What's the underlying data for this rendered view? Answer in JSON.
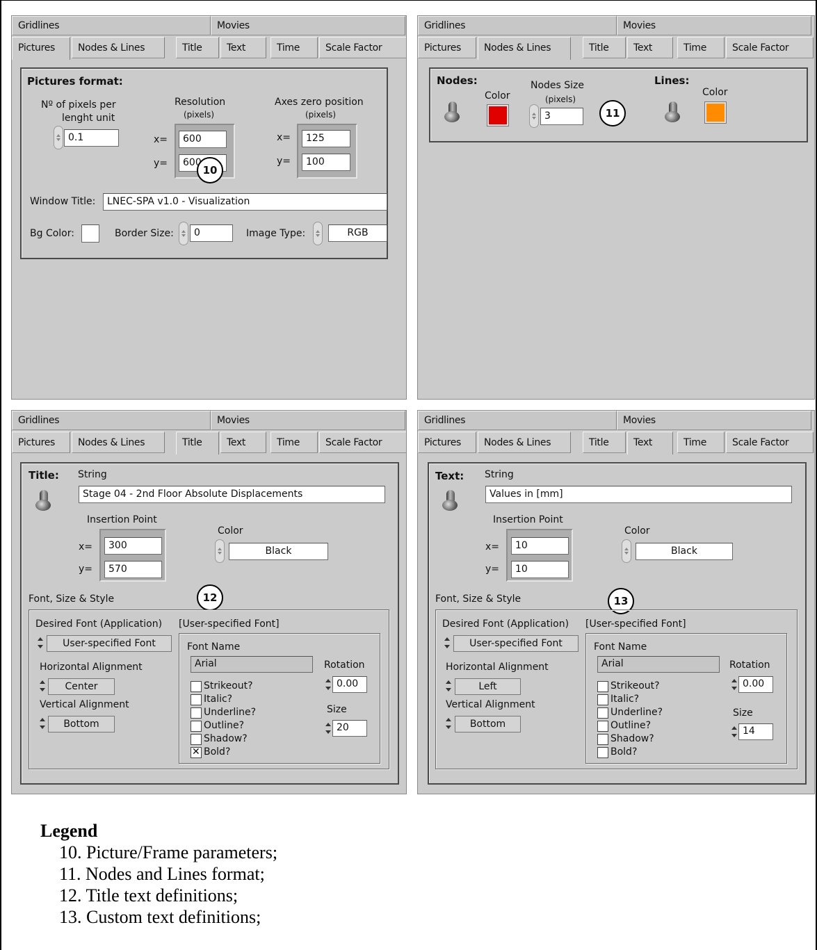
{
  "tabs_row1": [
    "Gridlines",
    "Movies"
  ],
  "tabs_row2": [
    "Pictures",
    "Nodes & Lines",
    "Title",
    "Text",
    "Time",
    "Scale Factor"
  ],
  "pictures": {
    "section_title": "Pictures format:",
    "pixels_label_1": "Nº of pixels per",
    "pixels_label_2": "lenght unit",
    "pixels_value": "0.1",
    "resolution_label": "Resolution",
    "resolution_unit": "(pixels)",
    "res_x_label": "x=",
    "res_x": "600",
    "res_y_label": "y=",
    "res_y": "600",
    "axes_label": "Axes zero position",
    "axes_unit": "(pixels)",
    "axes_x_label": "x=",
    "axes_x": "125",
    "axes_y_label": "y=",
    "axes_y": "100",
    "window_title_label": "Window Title:",
    "window_title": "LNEC-SPA v1.0 - Visualization",
    "bg_color_label": "Bg Color:",
    "bg_color": "#ffffff",
    "border_size_label": "Border Size:",
    "border_size": "0",
    "image_type_label": "Image Type:",
    "image_type": "RGB",
    "callout": "10"
  },
  "nodes": {
    "nodes_label": "Nodes:",
    "color_label": "Color",
    "node_color": "#e00000",
    "size_label": "Nodes Size",
    "size_unit": "(pixels)",
    "size_value": "3",
    "lines_label": "Lines:",
    "lines_color_label": "Color",
    "line_color": "#ff8c00",
    "callout": "11"
  },
  "title_panel": {
    "heading": "Title:",
    "string_label": "String",
    "string_value": "Stage 04 - 2nd Floor Absolute Displacements",
    "insertion_label": "Insertion Point",
    "x_label": "x=",
    "x": "300",
    "y_label": "y=",
    "y": "570",
    "color_label": "Color",
    "color_value": "Black",
    "font_group_label": "Font, Size & Style",
    "desired_font_label": "Desired Font (Application)",
    "desired_font": "User-specified Font",
    "user_font_label": "[User-specified Font]",
    "font_name_label": "Font Name",
    "font_name": "Arial",
    "h_align_label": "Horizontal Alignment",
    "h_align": "Center",
    "v_align_label": "Vertical Alignment",
    "v_align": "Bottom",
    "rotation_label": "Rotation",
    "rotation": "0.00",
    "size_label": "Size",
    "size": "20",
    "checks": [
      {
        "label": "Strikeout?",
        "checked": false
      },
      {
        "label": "Italic?",
        "checked": false
      },
      {
        "label": "Underline?",
        "checked": false
      },
      {
        "label": "Outline?",
        "checked": false
      },
      {
        "label": "Shadow?",
        "checked": false
      },
      {
        "label": "Bold?",
        "checked": true
      }
    ],
    "callout": "12"
  },
  "text_panel": {
    "heading": "Text:",
    "string_label": "String",
    "string_value": "Values in [mm]",
    "insertion_label": "Insertion Point",
    "x_label": "x=",
    "x": "10",
    "y_label": "y=",
    "y": "10",
    "color_label": "Color",
    "color_value": "Black",
    "font_group_label": "Font, Size & Style",
    "desired_font_label": "Desired Font (Application)",
    "desired_font": "User-specified Font",
    "user_font_label": "[User-specified Font]",
    "font_name_label": "Font Name",
    "font_name": "Arial",
    "h_align_label": "Horizontal Alignment",
    "h_align": "Left",
    "v_align_label": "Vertical Alignment",
    "v_align": "Bottom",
    "rotation_label": "Rotation",
    "rotation": "0.00",
    "size_label": "Size",
    "size": "14",
    "checks": [
      {
        "label": "Strikeout?",
        "checked": false
      },
      {
        "label": "Italic?",
        "checked": false
      },
      {
        "label": "Underline?",
        "checked": false
      },
      {
        "label": "Outline?",
        "checked": false
      },
      {
        "label": "Shadow?",
        "checked": false
      },
      {
        "label": "Bold?",
        "checked": false
      }
    ],
    "callout": "13"
  },
  "legend": {
    "title": "Legend",
    "items": [
      "10. Picture/Frame parameters;",
      "11. Nodes and Lines format;",
      "12. Title text definitions;",
      "13. Custom text definitions;"
    ]
  }
}
